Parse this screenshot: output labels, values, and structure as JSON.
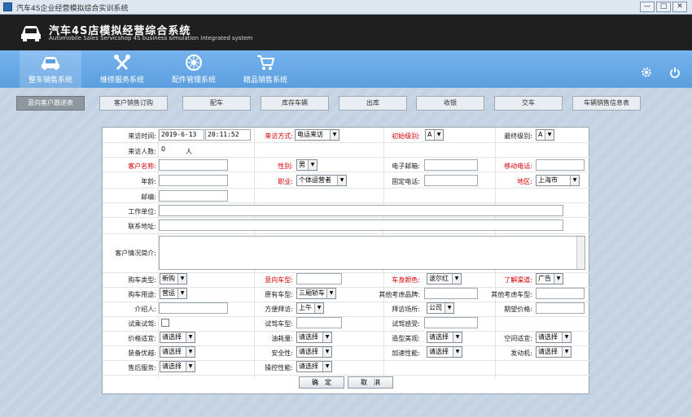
{
  "window": {
    "title": "汽车4S企业经营模拟综合实训系统",
    "min": "—",
    "max": "□",
    "close": "✕"
  },
  "header": {
    "title": "汽车4S店模拟经营综合系统",
    "subtitle": "Automobile Sales Servicshop 4S business simulation integrated system"
  },
  "modules": [
    {
      "label": "整车销售系统",
      "icon": "car-icon"
    },
    {
      "label": "维修服务系统",
      "icon": "wrench-icon"
    },
    {
      "label": "配件管理系统",
      "icon": "wheel-icon"
    },
    {
      "label": "精品销售系统",
      "icon": "cart-icon"
    }
  ],
  "top_icons": [
    "gear-icon",
    "power-icon"
  ],
  "subtabs": [
    "意向客户跟进表",
    "客户销售订购",
    "配车",
    "库存车辆",
    "出库",
    "收银",
    "交车",
    "车辆销售信息表"
  ],
  "form": {
    "visit_time_label": "来访时间:",
    "visit_date": "2019-6-13",
    "visit_clock": "20:11:52",
    "visit_method_label": "来访方式:",
    "visit_method": "电话来访",
    "initial_level_label": "初始级别:",
    "initial_level": "A",
    "final_level_label": "最终级别:",
    "final_level": "A",
    "visitors_label": "来访人数:",
    "visitors": "0",
    "visitors_unit": "人",
    "customer_name_label": "客户名称:",
    "gender_label": "性别:",
    "gender": "男",
    "email_label": "电子邮箱:",
    "mobile_label": "移动电话:",
    "age_label": "年龄:",
    "occupation_label": "职业:",
    "occupation": "个体运营者",
    "landline_label": "固定电话:",
    "region_label": "地区:",
    "region": "上海市",
    "postcode_label": "邮编:",
    "workplace_label": "工作单位:",
    "address_label": "联系地址:",
    "profile_label": "客户情况简介:",
    "purchase_type_label": "购车类型:",
    "purchase_type": "新购",
    "intended_model_label": "意向车型:",
    "body_color_label": "车身颜色:",
    "body_color": "波尔红",
    "channel_label": "了解渠道:",
    "channel": "广告",
    "purpose_label": "购车用途:",
    "purpose": "营运",
    "owned_model_label": "原有车型:",
    "owned_model": "三厢轿车",
    "other_brand_label": "其他考虑品牌:",
    "other_model_label": "其他考虑车型:",
    "introducer_label": "介绍人:",
    "convenient_visit_label": "方便拜访:",
    "convenient_visit": "上午",
    "visit_place_label": "拜访场所:",
    "visit_place": "公司",
    "expected_price_label": "期望价格:",
    "test_drive_label": "试乘试驾:",
    "test_model_label": "试驾车型:",
    "test_feel_label": "试驾感受:",
    "price_fit_label": "价格适宜:",
    "price_fit": "请选择",
    "fuel_label": "油耗量:",
    "fuel": "请选择",
    "styling_label": "造型美观:",
    "styling": "请选择",
    "space_label": "空间适宜:",
    "space": "请选择",
    "equipment_label": "装备优越:",
    "equipment": "请选择",
    "safety_label": "安全性:",
    "safety": "请选择",
    "accel_label": "加速性能:",
    "accel": "请选择",
    "engine_label": "发动机:",
    "engine": "请选择",
    "after_sales_label": "售后服务:",
    "after_sales": "请选择",
    "handling_label": "操控性能:",
    "handling": "请选择",
    "confirm": "确　定",
    "cancel": "取　消"
  }
}
